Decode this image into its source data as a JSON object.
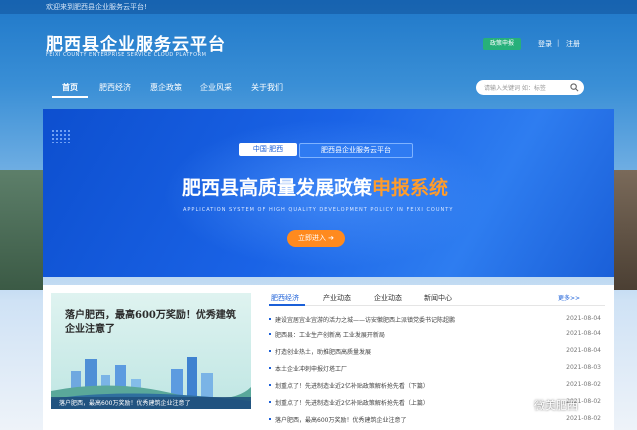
{
  "header": {
    "welcome": "欢迎来到肥西县企业服务云平台!",
    "title": "肥西县企业服务云平台",
    "subtitle": "FEIXI COUNTY ENTERPRISE SERVICE CLOUD PLATFORM",
    "policy_button": "政策申报",
    "login": "登录",
    "separator": "|",
    "register": "注册"
  },
  "nav": {
    "items": [
      {
        "label": "首页"
      },
      {
        "label": "肥西经济"
      },
      {
        "label": "惠企政策"
      },
      {
        "label": "企业风采"
      },
      {
        "label": "关于我们"
      }
    ]
  },
  "search": {
    "placeholder": "请输入关键词  如：标签"
  },
  "banner": {
    "tag_left": "中国·肥西",
    "tag_right": "肥西县企业服务云平台",
    "title_main": "肥西县高质量发展政策",
    "title_highlight": "申报系统",
    "title_en": "APPLICATION SYSTEM OF HIGH QUALITY DEVELOPMENT POLICY IN FEIXI COUNTY",
    "enter_button": "立即进入 ➔"
  },
  "promo": {
    "title": "落户肥西，最高600万奖励！优秀建筑企业注意了",
    "caption": "落户肥西，最高600万奖励！优秀建筑企业注意了"
  },
  "news": {
    "tabs": [
      {
        "label": "肥西经济"
      },
      {
        "label": "产业动态"
      },
      {
        "label": "企业动态"
      },
      {
        "label": "新闻中心"
      }
    ],
    "more": "更多>>",
    "items": [
      {
        "title": "建设宜居宜业宜游的活力之城——访安徽肥西上派镇党委书记陈超鹏",
        "date": "2021-08-04"
      },
      {
        "title": "肥西县：工业生产创新高 工业发展开新局",
        "date": "2021-08-04"
      },
      {
        "title": "打造创业热土，助推肥西高质量发展",
        "date": "2021-08-04"
      },
      {
        "title": "本土企业冲刺申报灯塔工厂",
        "date": "2021-08-03"
      },
      {
        "title": "划重点了！先进制造业近2亿补贴政策解析抢先看（下篇）",
        "date": "2021-08-02"
      },
      {
        "title": "划重点了！先进制造业近2亿补贴政策解析抢先看（上篇）",
        "date": "2021-08-02"
      },
      {
        "title": "落户肥西，最高600万奖励！优秀建筑企业注意了",
        "date": "2021-08-02"
      }
    ]
  },
  "watermark": "微美肥西",
  "colors": {
    "accent": "#1a5fd8",
    "highlight": "#ff9c2b",
    "button_orange": "#ff8a1e",
    "button_green": "#27b07a"
  }
}
